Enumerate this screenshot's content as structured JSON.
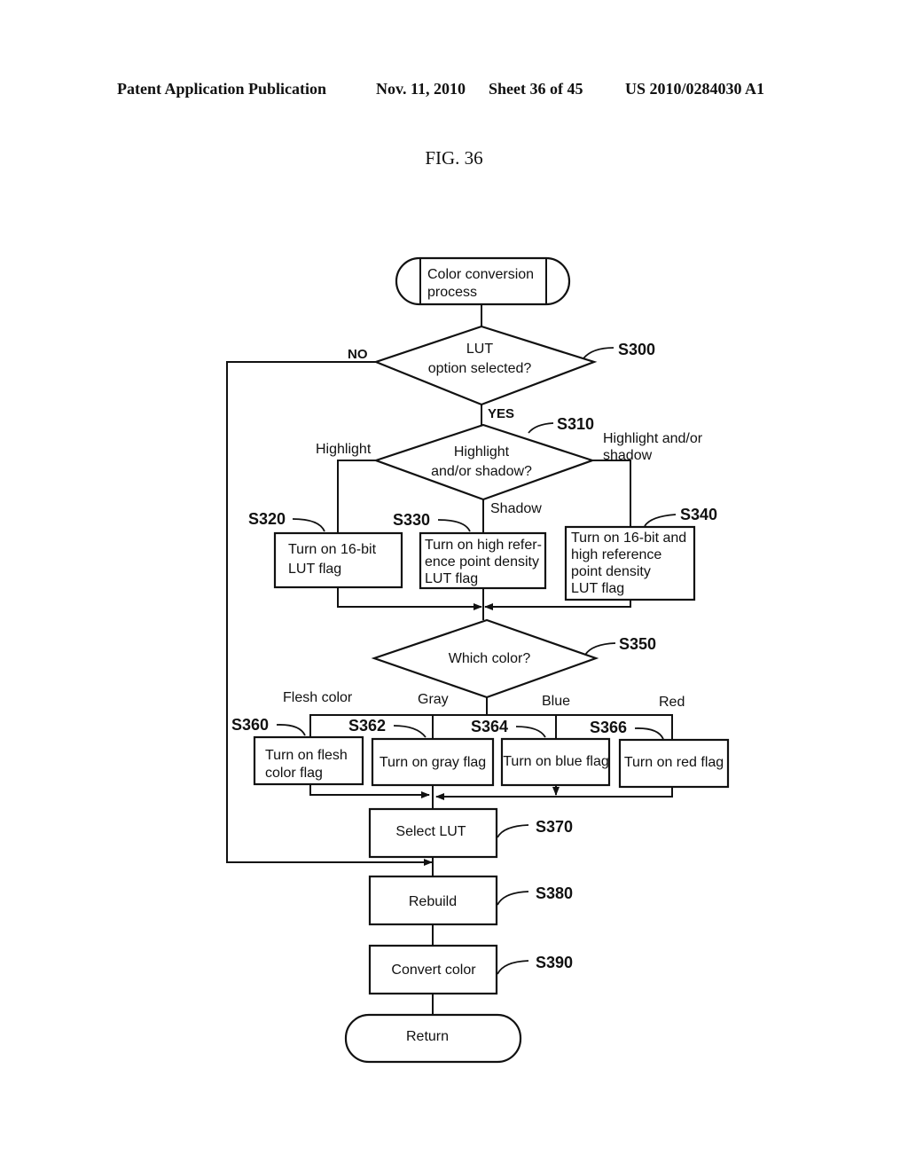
{
  "header": {
    "publication": "Patent Application Publication",
    "date": "Nov. 11, 2010",
    "sheet": "Sheet 36 of 45",
    "number": "US 2010/0284030 A1"
  },
  "figure_label": "FIG. 36",
  "flowchart": {
    "start": {
      "lines": [
        "Color conversion",
        "process"
      ]
    },
    "s300": {
      "step": "S300",
      "lines": [
        "LUT",
        "option selected?"
      ],
      "no": "NO",
      "yes": "YES"
    },
    "s310": {
      "step": "S310",
      "lines": [
        "Highlight",
        "and/or shadow?"
      ],
      "left": "Highlight",
      "bottom": "Shadow",
      "right_lines": [
        "Highlight and/or",
        "shadow"
      ]
    },
    "s320": {
      "step": "S320",
      "lines": [
        "Turn on 16-bit",
        "LUT flag"
      ]
    },
    "s330": {
      "step": "S330",
      "lines": [
        "Turn on high refer-",
        "ence point density",
        "LUT flag"
      ]
    },
    "s340": {
      "step": "S340",
      "lines": [
        "Turn on 16-bit and",
        "high reference",
        "point density",
        "LUT flag"
      ]
    },
    "s350": {
      "step": "S350",
      "lines": [
        "Which color?"
      ],
      "branches": [
        "Flesh color",
        "Gray",
        "Blue",
        "Red"
      ]
    },
    "s360": {
      "step": "S360",
      "lines": [
        "Turn on flesh",
        "color flag"
      ]
    },
    "s362": {
      "step": "S362",
      "lines": [
        "Turn on gray flag"
      ]
    },
    "s364": {
      "step": "S364",
      "lines": [
        "Turn on blue flag"
      ]
    },
    "s366": {
      "step": "S366",
      "lines": [
        "Turn on red flag"
      ]
    },
    "s370": {
      "step": "S370",
      "lines": [
        "Select LUT"
      ]
    },
    "s380": {
      "step": "S380",
      "lines": [
        "Rebuild"
      ]
    },
    "s390": {
      "step": "S390",
      "lines": [
        "Convert color"
      ]
    },
    "end": {
      "lines": [
        "Return"
      ]
    }
  }
}
